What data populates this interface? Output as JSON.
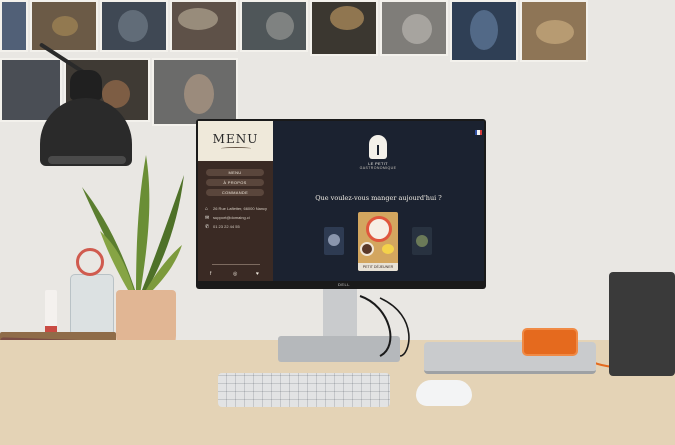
{
  "site": {
    "logo": "MENU",
    "nav": [
      "MENU",
      "À PROPOS",
      "COMMANDE"
    ],
    "info": [
      {
        "icon": "home-icon",
        "text": "26 Rue Lafletter, 66000 Nancy"
      },
      {
        "icon": "mail-icon",
        "text": "support@domaing.ci"
      },
      {
        "icon": "phone-icon",
        "text": "01 23 22 44 55"
      }
    ],
    "social": [
      "f",
      "◎",
      "♥"
    ],
    "brand_name": "LE PETIT",
    "brand_sub": "GASTRONOMIQUE",
    "question": "Que voulez-vous manger aujourd'hui ?",
    "featured_label": "PETIT DÉJEUNER",
    "monitor_brand": "DELL"
  },
  "colors": {
    "screen_bg": "#1b2230",
    "sidebar_bg": "#3a2a24",
    "sidebar_head": "#efe9da",
    "nav_button": "#5a463c",
    "accent_orange": "#e56a1e"
  }
}
